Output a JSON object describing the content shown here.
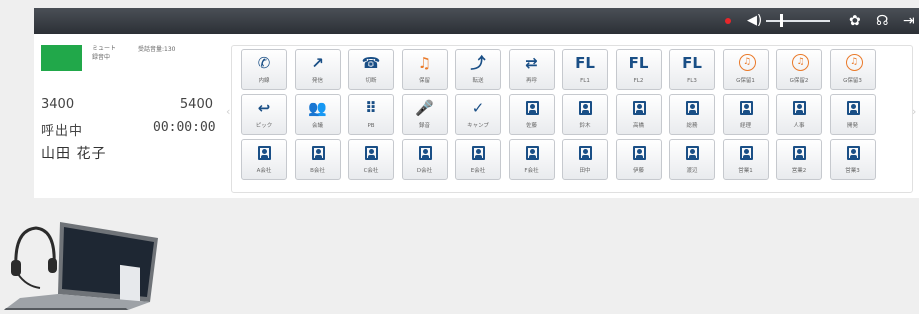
{
  "status": {
    "mute": "ミュート",
    "state_small": "録音中",
    "queue": "受話音量:130",
    "line_left": "3400",
    "line_right": "5400",
    "call_state": "呼出中",
    "timer": "00:00:00",
    "caller_name": "山田 花子",
    "status_color": "#21a84a"
  },
  "toolbar": {
    "volume_icon": "speaker-icon",
    "volume_level": 0.2,
    "icons": [
      "gear-icon",
      "headset-icon",
      "logout-icon"
    ]
  },
  "keys": [
    [
      {
        "icon": "phone-icon",
        "glyph": "✆",
        "label": "内線",
        "style": "blue"
      },
      {
        "icon": "outgoing-call-icon",
        "glyph": "↗",
        "label": "発信",
        "style": "blue"
      },
      {
        "icon": "hangup-icon",
        "glyph": "☎",
        "label": "切断",
        "style": "blue"
      },
      {
        "icon": "music-note-icon",
        "glyph": "♫",
        "label": "保留",
        "style": "orange"
      },
      {
        "icon": "transfer-icon",
        "glyph": "⤴",
        "label": "転送",
        "style": "blue"
      },
      {
        "icon": "swap-icon",
        "glyph": "⇄",
        "label": "再呼",
        "style": "blue"
      },
      {
        "icon": "fl-icon",
        "glyph": "FL",
        "label": "FL1",
        "style": "fl"
      },
      {
        "icon": "fl-icon",
        "glyph": "FL",
        "label": "FL2",
        "style": "fl"
      },
      {
        "icon": "fl-icon",
        "glyph": "FL",
        "label": "FL3",
        "style": "fl"
      },
      {
        "icon": "hold-circle-icon",
        "glyph": "♫",
        "label": "G保留1",
        "style": "circle"
      },
      {
        "icon": "hold-circle-icon",
        "glyph": "♫",
        "label": "G保留2",
        "style": "circle"
      },
      {
        "icon": "hold-circle-icon",
        "glyph": "♫",
        "label": "G保留3",
        "style": "circle"
      }
    ],
    [
      {
        "icon": "pickup-icon",
        "glyph": "↩",
        "label": "ピック",
        "style": "blue"
      },
      {
        "icon": "conference-icon",
        "glyph": "👥",
        "label": "会議",
        "style": "blue"
      },
      {
        "icon": "keypad-icon",
        "glyph": "⠿",
        "label": "PB",
        "style": "blue"
      },
      {
        "icon": "microphone-icon",
        "glyph": "🎤",
        "label": "録音",
        "style": "blue"
      },
      {
        "icon": "camp-on-icon",
        "glyph": "✓",
        "label": "キャンプ",
        "style": "blue"
      },
      {
        "icon": "contact-icon",
        "glyph": "",
        "label": "佐藤",
        "style": "person"
      },
      {
        "icon": "contact-icon",
        "glyph": "",
        "label": "鈴木",
        "style": "person"
      },
      {
        "icon": "contact-icon",
        "glyph": "",
        "label": "高橋",
        "style": "person"
      },
      {
        "icon": "contact-icon",
        "glyph": "",
        "label": "総務",
        "style": "person"
      },
      {
        "icon": "contact-icon",
        "glyph": "",
        "label": "経理",
        "style": "person"
      },
      {
        "icon": "contact-icon",
        "glyph": "",
        "label": "人事",
        "style": "person"
      },
      {
        "icon": "contact-icon",
        "glyph": "",
        "label": "開発",
        "style": "person"
      }
    ],
    [
      {
        "icon": "contact-icon",
        "glyph": "",
        "label": "A会社",
        "style": "person"
      },
      {
        "icon": "contact-icon",
        "glyph": "",
        "label": "B会社",
        "style": "person"
      },
      {
        "icon": "contact-icon",
        "glyph": "",
        "label": "C会社",
        "style": "person"
      },
      {
        "icon": "contact-icon",
        "glyph": "",
        "label": "D会社",
        "style": "person"
      },
      {
        "icon": "contact-icon",
        "glyph": "",
        "label": "E会社",
        "style": "person"
      },
      {
        "icon": "contact-icon",
        "glyph": "",
        "label": "F会社",
        "style": "person"
      },
      {
        "icon": "contact-icon",
        "glyph": "",
        "label": "田中",
        "style": "person"
      },
      {
        "icon": "contact-icon",
        "glyph": "",
        "label": "伊藤",
        "style": "person"
      },
      {
        "icon": "contact-icon",
        "glyph": "",
        "label": "渡辺",
        "style": "person"
      },
      {
        "icon": "contact-icon",
        "glyph": "",
        "label": "営業1",
        "style": "person"
      },
      {
        "icon": "contact-icon",
        "glyph": "",
        "label": "営業2",
        "style": "person"
      },
      {
        "icon": "contact-icon",
        "glyph": "",
        "label": "営業3",
        "style": "person"
      }
    ]
  ]
}
